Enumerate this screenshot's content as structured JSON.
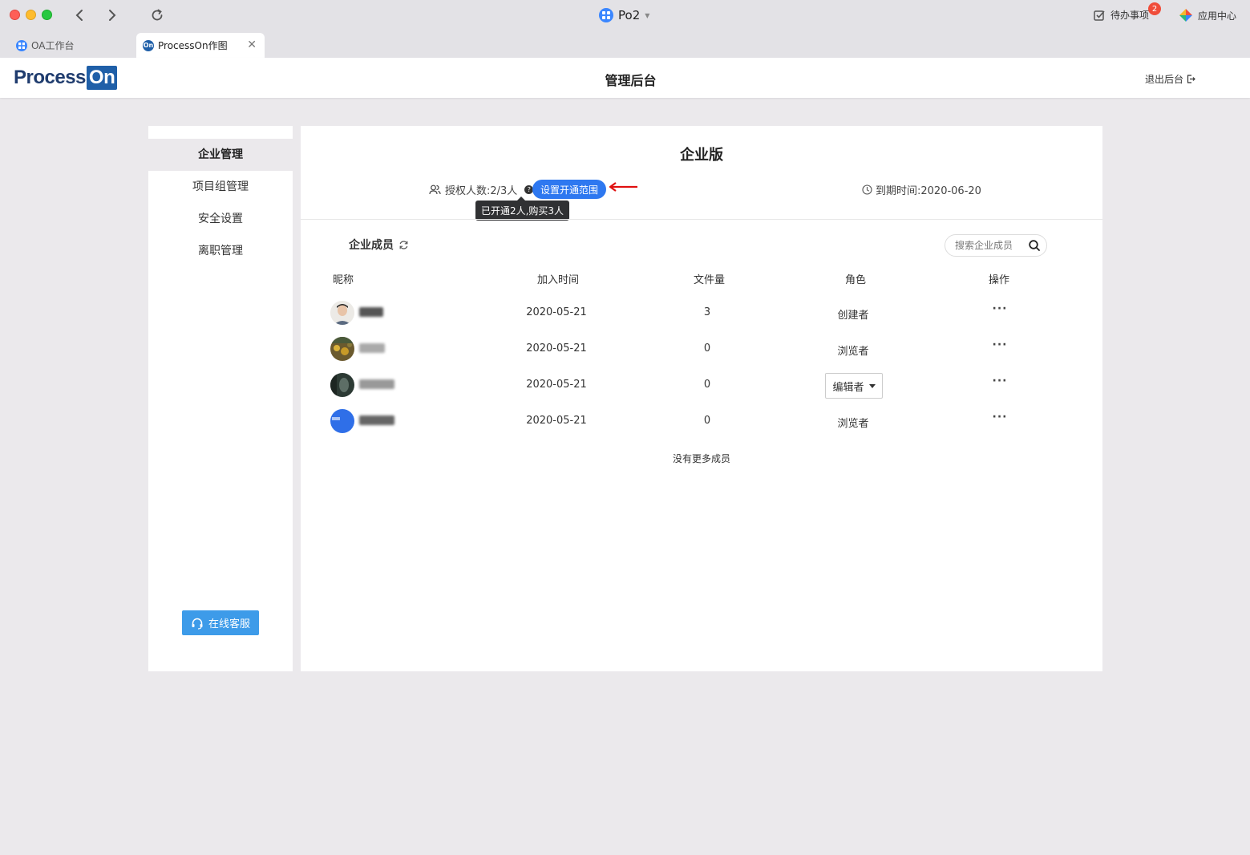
{
  "window": {
    "app_title": "Po2",
    "todo_label": "待办事项",
    "todo_badge": "2",
    "app_center_label": "应用中心"
  },
  "tabs": [
    {
      "label": "OA工作台"
    },
    {
      "label": "ProcessOn作图",
      "active": true
    }
  ],
  "header": {
    "logo_text": "Process",
    "logo_on": "On",
    "title": "管理后台",
    "logout_label": "退出后台"
  },
  "sidebar": {
    "items": [
      {
        "label": "企业管理",
        "active": true
      },
      {
        "label": "项目组管理"
      },
      {
        "label": "安全设置"
      },
      {
        "label": "离职管理"
      }
    ],
    "service_button": "在线客服"
  },
  "main": {
    "edition": "企业版",
    "auth_count": "授权人数:2/3人",
    "scope_button": "设置开通范围",
    "tooltip": "已开通2人,购买3人",
    "expire": "到期时间:2020-06-20",
    "members_title": "企业成员",
    "search_placeholder": "搜索企业成员",
    "columns": [
      "昵称",
      "加入时间",
      "文件量",
      "角色",
      "操作"
    ],
    "members": [
      {
        "joined": "2020-05-21",
        "files": "3",
        "role": "创建者",
        "role_editable": false
      },
      {
        "joined": "2020-05-21",
        "files": "0",
        "role": "浏览者",
        "role_editable": false
      },
      {
        "joined": "2020-05-21",
        "files": "0",
        "role": "编辑者",
        "role_editable": true
      },
      {
        "joined": "2020-05-21",
        "files": "0",
        "role": "浏览者",
        "role_editable": false
      }
    ],
    "more_label": "···",
    "no_more": "没有更多成员"
  },
  "colors": {
    "accent_blue": "#2e78f0",
    "service_blue": "#3d9be9",
    "annotation_red": "#e01010",
    "background": "#ebe9ec"
  }
}
